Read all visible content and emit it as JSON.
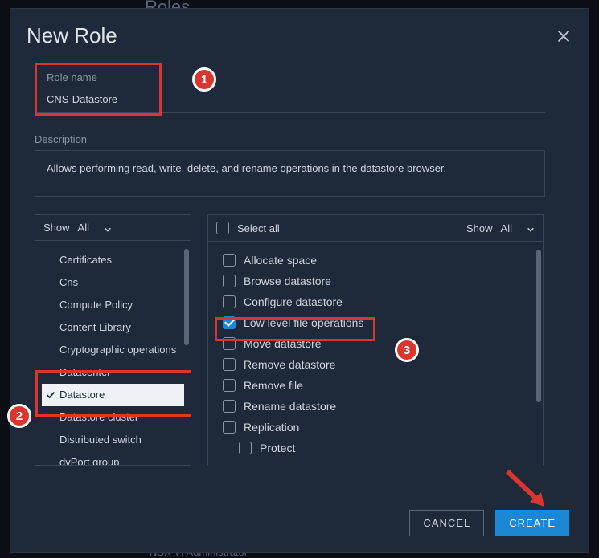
{
  "bg": {
    "roles": "Roles",
    "footer": "NSX VI Administrator"
  },
  "dialog": {
    "title": "New Role",
    "role_name_label": "Role name",
    "role_name_value": "CNS-Datastore",
    "description_label": "Description",
    "description_value": "Allows performing read, write, delete, and rename operations in the datastore browser."
  },
  "filters": {
    "show_label": "Show",
    "all_label": "All",
    "select_all_label": "Select all"
  },
  "categories": [
    "Certificates",
    "Cns",
    "Compute Policy",
    "Content Library",
    "Cryptographic operations",
    "Datacenter",
    "Datastore",
    "Datastore cluster",
    "Distributed switch",
    "dvPort group"
  ],
  "selected_category_index": 6,
  "permissions": [
    {
      "label": "Allocate space",
      "checked": false
    },
    {
      "label": "Browse datastore",
      "checked": false
    },
    {
      "label": "Configure datastore",
      "checked": false
    },
    {
      "label": "Low level file operations",
      "checked": true
    },
    {
      "label": "Move datastore",
      "checked": false
    },
    {
      "label": "Remove datastore",
      "checked": false
    },
    {
      "label": "Remove file",
      "checked": false
    },
    {
      "label": "Rename datastore",
      "checked": false
    },
    {
      "label": "Replication",
      "checked": false
    }
  ],
  "sub_permission": {
    "label": "Protect",
    "checked": false
  },
  "buttons": {
    "cancel": "CANCEL",
    "create": "CREATE"
  },
  "annotations": {
    "b1": "1",
    "b2": "2",
    "b3": "3"
  }
}
